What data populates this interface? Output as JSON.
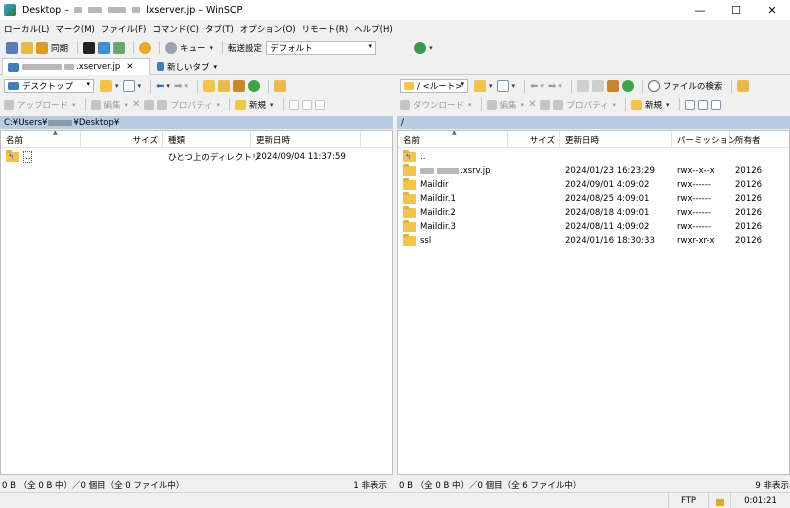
{
  "window": {
    "title_prefix": "Desktop –",
    "title_suffix": "lxserver.jp – WinSCP",
    "minimize": "—",
    "maximize": "☐",
    "close": "✕"
  },
  "menu": [
    "ローカル(L)",
    "マーク(M)",
    "ファイル(F)",
    "コマンド(C)",
    "タブ(T)",
    "オプション(O)",
    "リモート(R)",
    "ヘルプ(H)"
  ],
  "toolbar": {
    "sync_label": "同期",
    "queue_label": "キュー",
    "transfer_settings_label": "転送設定",
    "transfer_preset": "デフォルト"
  },
  "tabs": {
    "session_tab_label": ".xserver.jp",
    "close": "✕",
    "new_tab_label": "新しいタブ"
  },
  "local": {
    "location": "デスクトップ",
    "upload_label": "アップロード",
    "edit_label": "編集",
    "properties_label": "プロパティ",
    "new_label": "新規",
    "path_prefix": "C:¥Users¥",
    "path_suffix": "¥Desktop¥",
    "columns": [
      "名前",
      "サイズ",
      "種類",
      "更新日時"
    ],
    "rows": [
      {
        "name": "..",
        "size": "",
        "type": "ひとつ上のディレクトリ",
        "modified": "2024/09/04 11:37:59"
      }
    ],
    "status_left": "0 B （全 0 B 中）／0 個目（全 0 ファイル中）",
    "status_right": "1 非表示"
  },
  "remote": {
    "location": "/ <ルート>",
    "find_files_label": "ファイルの検索",
    "download_label": "ダウンロード",
    "edit_label": "編集",
    "properties_label": "プロパティ",
    "new_label": "新規",
    "path": "/",
    "columns": [
      "名前",
      "サイズ",
      "更新日時",
      "パーミッション",
      "所有者"
    ],
    "rows": [
      {
        "name": "..",
        "size": "",
        "modified": "",
        "permissions": "",
        "owner": ""
      },
      {
        "name": ".xsrv.jp",
        "size": "",
        "modified": "2024/01/23 16:23:29",
        "permissions": "rwx--x--x",
        "owner": "20126"
      },
      {
        "name": "Maildir",
        "size": "",
        "modified": "2024/09/01 4:09:02",
        "permissions": "rwx------",
        "owner": "20126"
      },
      {
        "name": "Maildir.1",
        "size": "",
        "modified": "2024/08/25 4:09:01",
        "permissions": "rwx------",
        "owner": "20126"
      },
      {
        "name": "Maildir.2",
        "size": "",
        "modified": "2024/08/18 4:09:01",
        "permissions": "rwx------",
        "owner": "20126"
      },
      {
        "name": "Maildir.3",
        "size": "",
        "modified": "2024/08/11 4:09:02",
        "permissions": "rwx------",
        "owner": "20126"
      },
      {
        "name": "ssl",
        "size": "",
        "modified": "2024/01/16 18:30:33",
        "permissions": "rwxr-xr-x",
        "owner": "20126"
      }
    ],
    "status_left": "0 B （全 0 B 中）／0 個目（全 6 ファイル中）",
    "status_right": "9 非表示"
  },
  "bottom": {
    "protocol": "FTP",
    "elapsed": "0:01:21"
  },
  "colors": {
    "path_bar": "#b7cbe2",
    "folder": "#f2c44e"
  }
}
